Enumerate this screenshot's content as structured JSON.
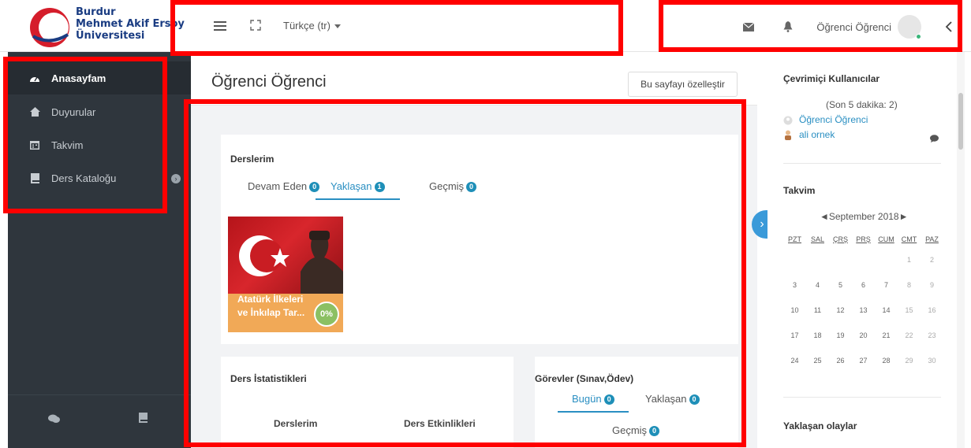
{
  "brand": {
    "name_lines": [
      "Burdur",
      "Mehmet Akif Ersoy",
      "Üniversitesi"
    ]
  },
  "topbar": {
    "language": "Türkçe (tr)",
    "user_name": "Öğrenci Öğrenci"
  },
  "sidebar": {
    "items": [
      {
        "label": "Anasayfam",
        "icon": "dashboard-icon"
      },
      {
        "label": "Duyurular",
        "icon": "home-icon"
      },
      {
        "label": "Takvim",
        "icon": "calendar-icon"
      },
      {
        "label": "Ders Kataloğu",
        "icon": "book-icon"
      }
    ],
    "footer_icons": [
      "chat-icon",
      "book-icon"
    ]
  },
  "main": {
    "page_title": "Öğrenci Öğrenci",
    "customize_button": "Bu sayfayı özelleştir",
    "my_courses": {
      "title": "Derslerim",
      "tabs": [
        {
          "label": "Devam Eden",
          "count": "0"
        },
        {
          "label": "Yaklaşan",
          "count": "1"
        },
        {
          "label": "Geçmiş",
          "count": "0"
        }
      ],
      "course": {
        "name": "Atatürk İlkeleri ve İnkılap Tar...",
        "progress": "0%"
      }
    },
    "stats": {
      "title": "Ders İstatistikleri",
      "col1": "Derslerim",
      "col2": "Ders Etkinlikleri"
    },
    "tasks": {
      "title": "Görevler (Sınav,Ödev)",
      "tabs": [
        {
          "label": "Bugün",
          "count": "0"
        },
        {
          "label": "Yaklaşan",
          "count": "0"
        },
        {
          "label": "Geçmiş",
          "count": "0"
        }
      ]
    }
  },
  "right_panel": {
    "online": {
      "title": "Çevrimiçi Kullanıcılar",
      "subtitle": "(Son 5 dakika: 2)",
      "users": [
        "Öğrenci Öğrenci",
        "ali ornek"
      ]
    },
    "calendar": {
      "title": "Takvim",
      "month": "◄September 2018►",
      "weekdays": [
        "PZT",
        "SAL",
        "ÇRŞ",
        "PRŞ",
        "CUM",
        "CMT",
        "PAZ"
      ],
      "weeks": [
        [
          "",
          "",
          "",
          "",
          "",
          "1",
          "2"
        ],
        [
          "3",
          "4",
          "5",
          "6",
          "7",
          "8",
          "9"
        ],
        [
          "10",
          "11",
          "12",
          "13",
          "14",
          "15",
          "16"
        ],
        [
          "17",
          "18",
          "19",
          "20",
          "21",
          "22",
          "23"
        ],
        [
          "24",
          "25",
          "26",
          "27",
          "28",
          "29",
          "30"
        ]
      ]
    },
    "upcoming": {
      "title": "Yaklaşan olaylar"
    }
  },
  "colors": {
    "sidebar_bg": "#2f363d",
    "accent": "#2a8fc2",
    "badge": "#1e8fb8",
    "annotation": "#ff0000",
    "course_footer": "#f1a957"
  }
}
